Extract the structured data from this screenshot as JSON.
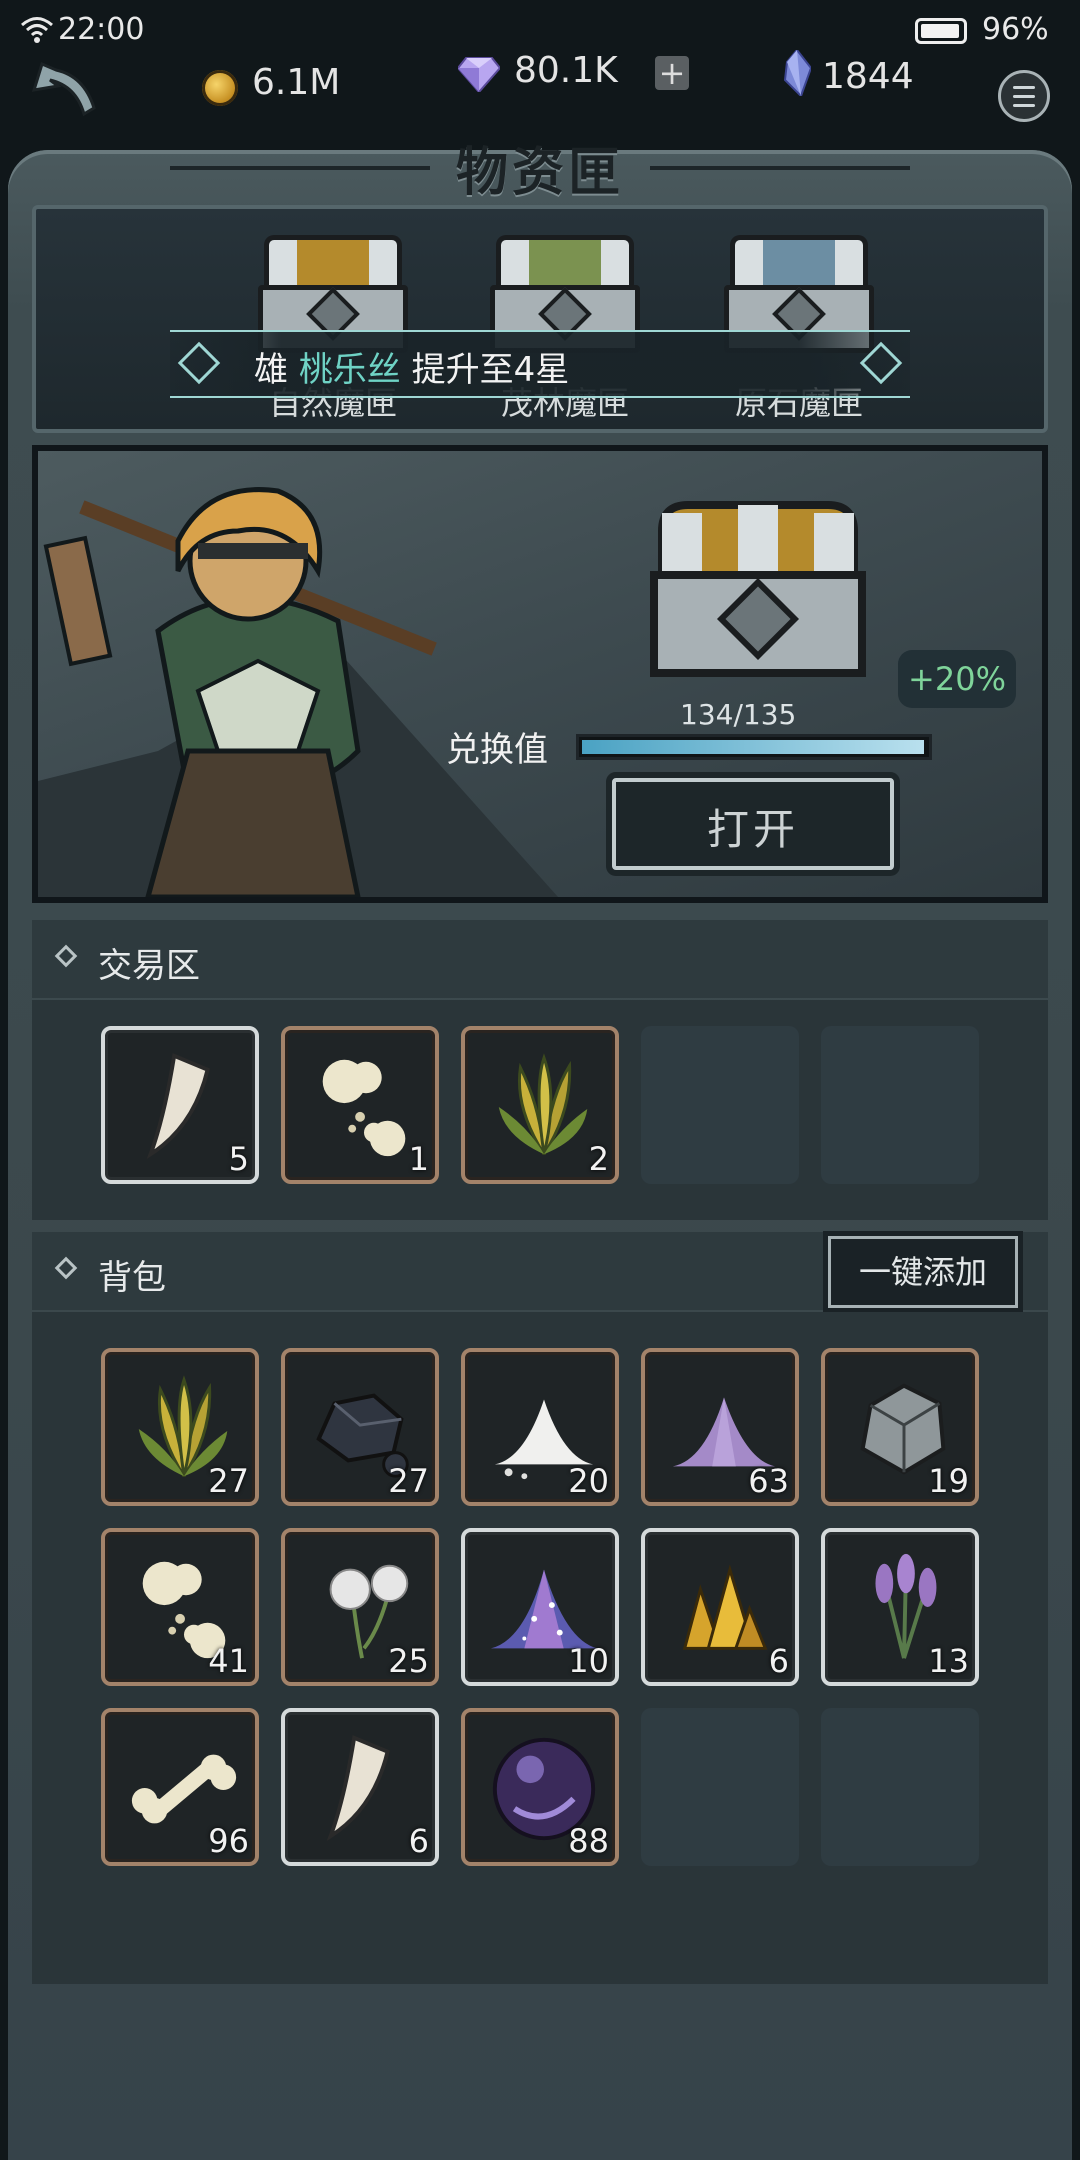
{
  "status_bar": {
    "time": "22:00",
    "battery": "96%"
  },
  "currency": {
    "gold": "6.1M",
    "gems": "80.1K",
    "plus": "+",
    "crystals": "1844"
  },
  "title": "物资匣",
  "chests": [
    {
      "label": "自然魔匣",
      "color": "#b48a2c"
    },
    {
      "label": "茂林魔匣",
      "color": "#7b9250"
    },
    {
      "label": "原石魔匣",
      "color": "#6c8ea3"
    }
  ],
  "toast": {
    "prefix": "雄",
    "hero": "桃乐丝",
    "suffix": "提升至4星"
  },
  "exchange": {
    "bonus": "+20%",
    "progress_text": "134/135",
    "label": "兑换值",
    "progress": 0.993,
    "open_button": "打开"
  },
  "trade_zone": {
    "label": "交易区",
    "items": [
      {
        "icon": "fang-icon",
        "count": "5",
        "frame": "silver"
      },
      {
        "icon": "bone-fragments-icon",
        "count": "1",
        "frame": "brown"
      },
      {
        "icon": "herb-icon",
        "count": "2",
        "frame": "brown"
      }
    ]
  },
  "backpack": {
    "label": "背包",
    "quick_add": "一键添加",
    "items": [
      {
        "icon": "herb-icon",
        "count": "27",
        "frame": "brown"
      },
      {
        "icon": "coal-icon",
        "count": "27",
        "frame": "brown"
      },
      {
        "icon": "white-powder-icon",
        "count": "20",
        "frame": "brown"
      },
      {
        "icon": "purple-powder-icon",
        "count": "63",
        "frame": "brown"
      },
      {
        "icon": "ore-icon",
        "count": "19",
        "frame": "brown"
      },
      {
        "icon": "bone-fragments-icon",
        "count": "41",
        "frame": "brown"
      },
      {
        "icon": "dandelion-icon",
        "count": "25",
        "frame": "brown"
      },
      {
        "icon": "starry-dust-icon",
        "count": "10",
        "frame": "silver"
      },
      {
        "icon": "gold-crystal-icon",
        "count": "6",
        "frame": "silver"
      },
      {
        "icon": "lavender-icon",
        "count": "13",
        "frame": "silver"
      },
      {
        "icon": "bone-icon",
        "count": "96",
        "frame": "brown"
      },
      {
        "icon": "fang-icon",
        "count": "6",
        "frame": "silver"
      },
      {
        "icon": "dark-orb-icon",
        "count": "88",
        "frame": "brown"
      }
    ]
  }
}
